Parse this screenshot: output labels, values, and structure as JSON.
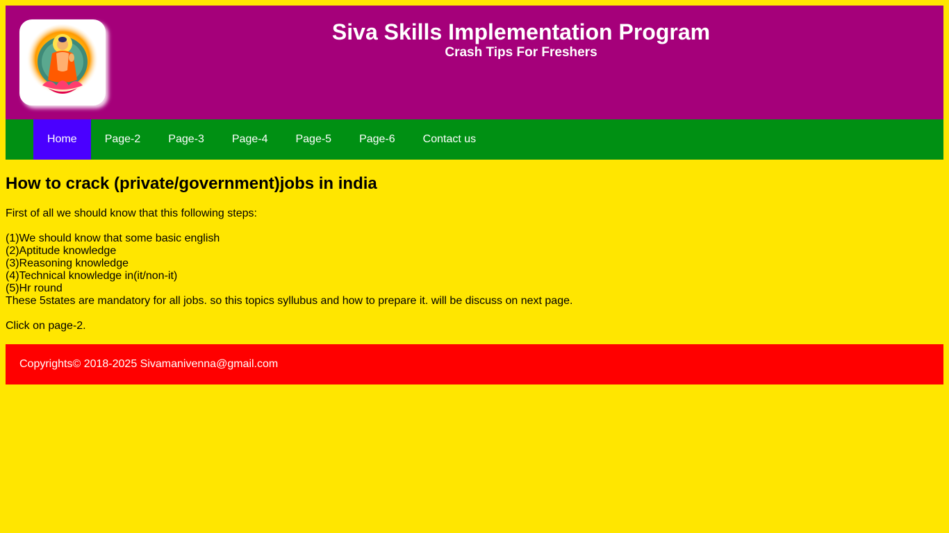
{
  "header": {
    "title": "Siva Skills Implementation Program",
    "subtitle": "Crash Tips For Freshers",
    "logo_icon": "buddha-logo-icon",
    "background_color": "#a5007a"
  },
  "nav": {
    "background_color": "#009013",
    "active_color": "#4a00ff",
    "items": [
      {
        "label": "Home",
        "active": true
      },
      {
        "label": "Page-2",
        "active": false
      },
      {
        "label": "Page-3",
        "active": false
      },
      {
        "label": "Page-4",
        "active": false
      },
      {
        "label": "Page-5",
        "active": false
      },
      {
        "label": "Page-6",
        "active": false
      },
      {
        "label": "Contact us",
        "active": false
      }
    ]
  },
  "content": {
    "heading": "How to crack (private/government)jobs in india",
    "intro": "First of all we should know that this following steps:",
    "steps": [
      "(1)We should know that some basic english",
      "(2)Aptitude knowledge",
      "(3)Reasoning knowledge",
      "(4)Technical knowledge in(it/non-it)",
      "(5)Hr round"
    ],
    "note": "These 5states are mandatory for all jobs. so this topics syllubus and how to prepare it. will be discuss on next page.",
    "click_text": "Click on page-2."
  },
  "footer": {
    "text": "Copyrights© 2018-2025 Sivamanivenna@gmail.com",
    "background_color": "#ff0000"
  },
  "page_background": "#ffe600"
}
